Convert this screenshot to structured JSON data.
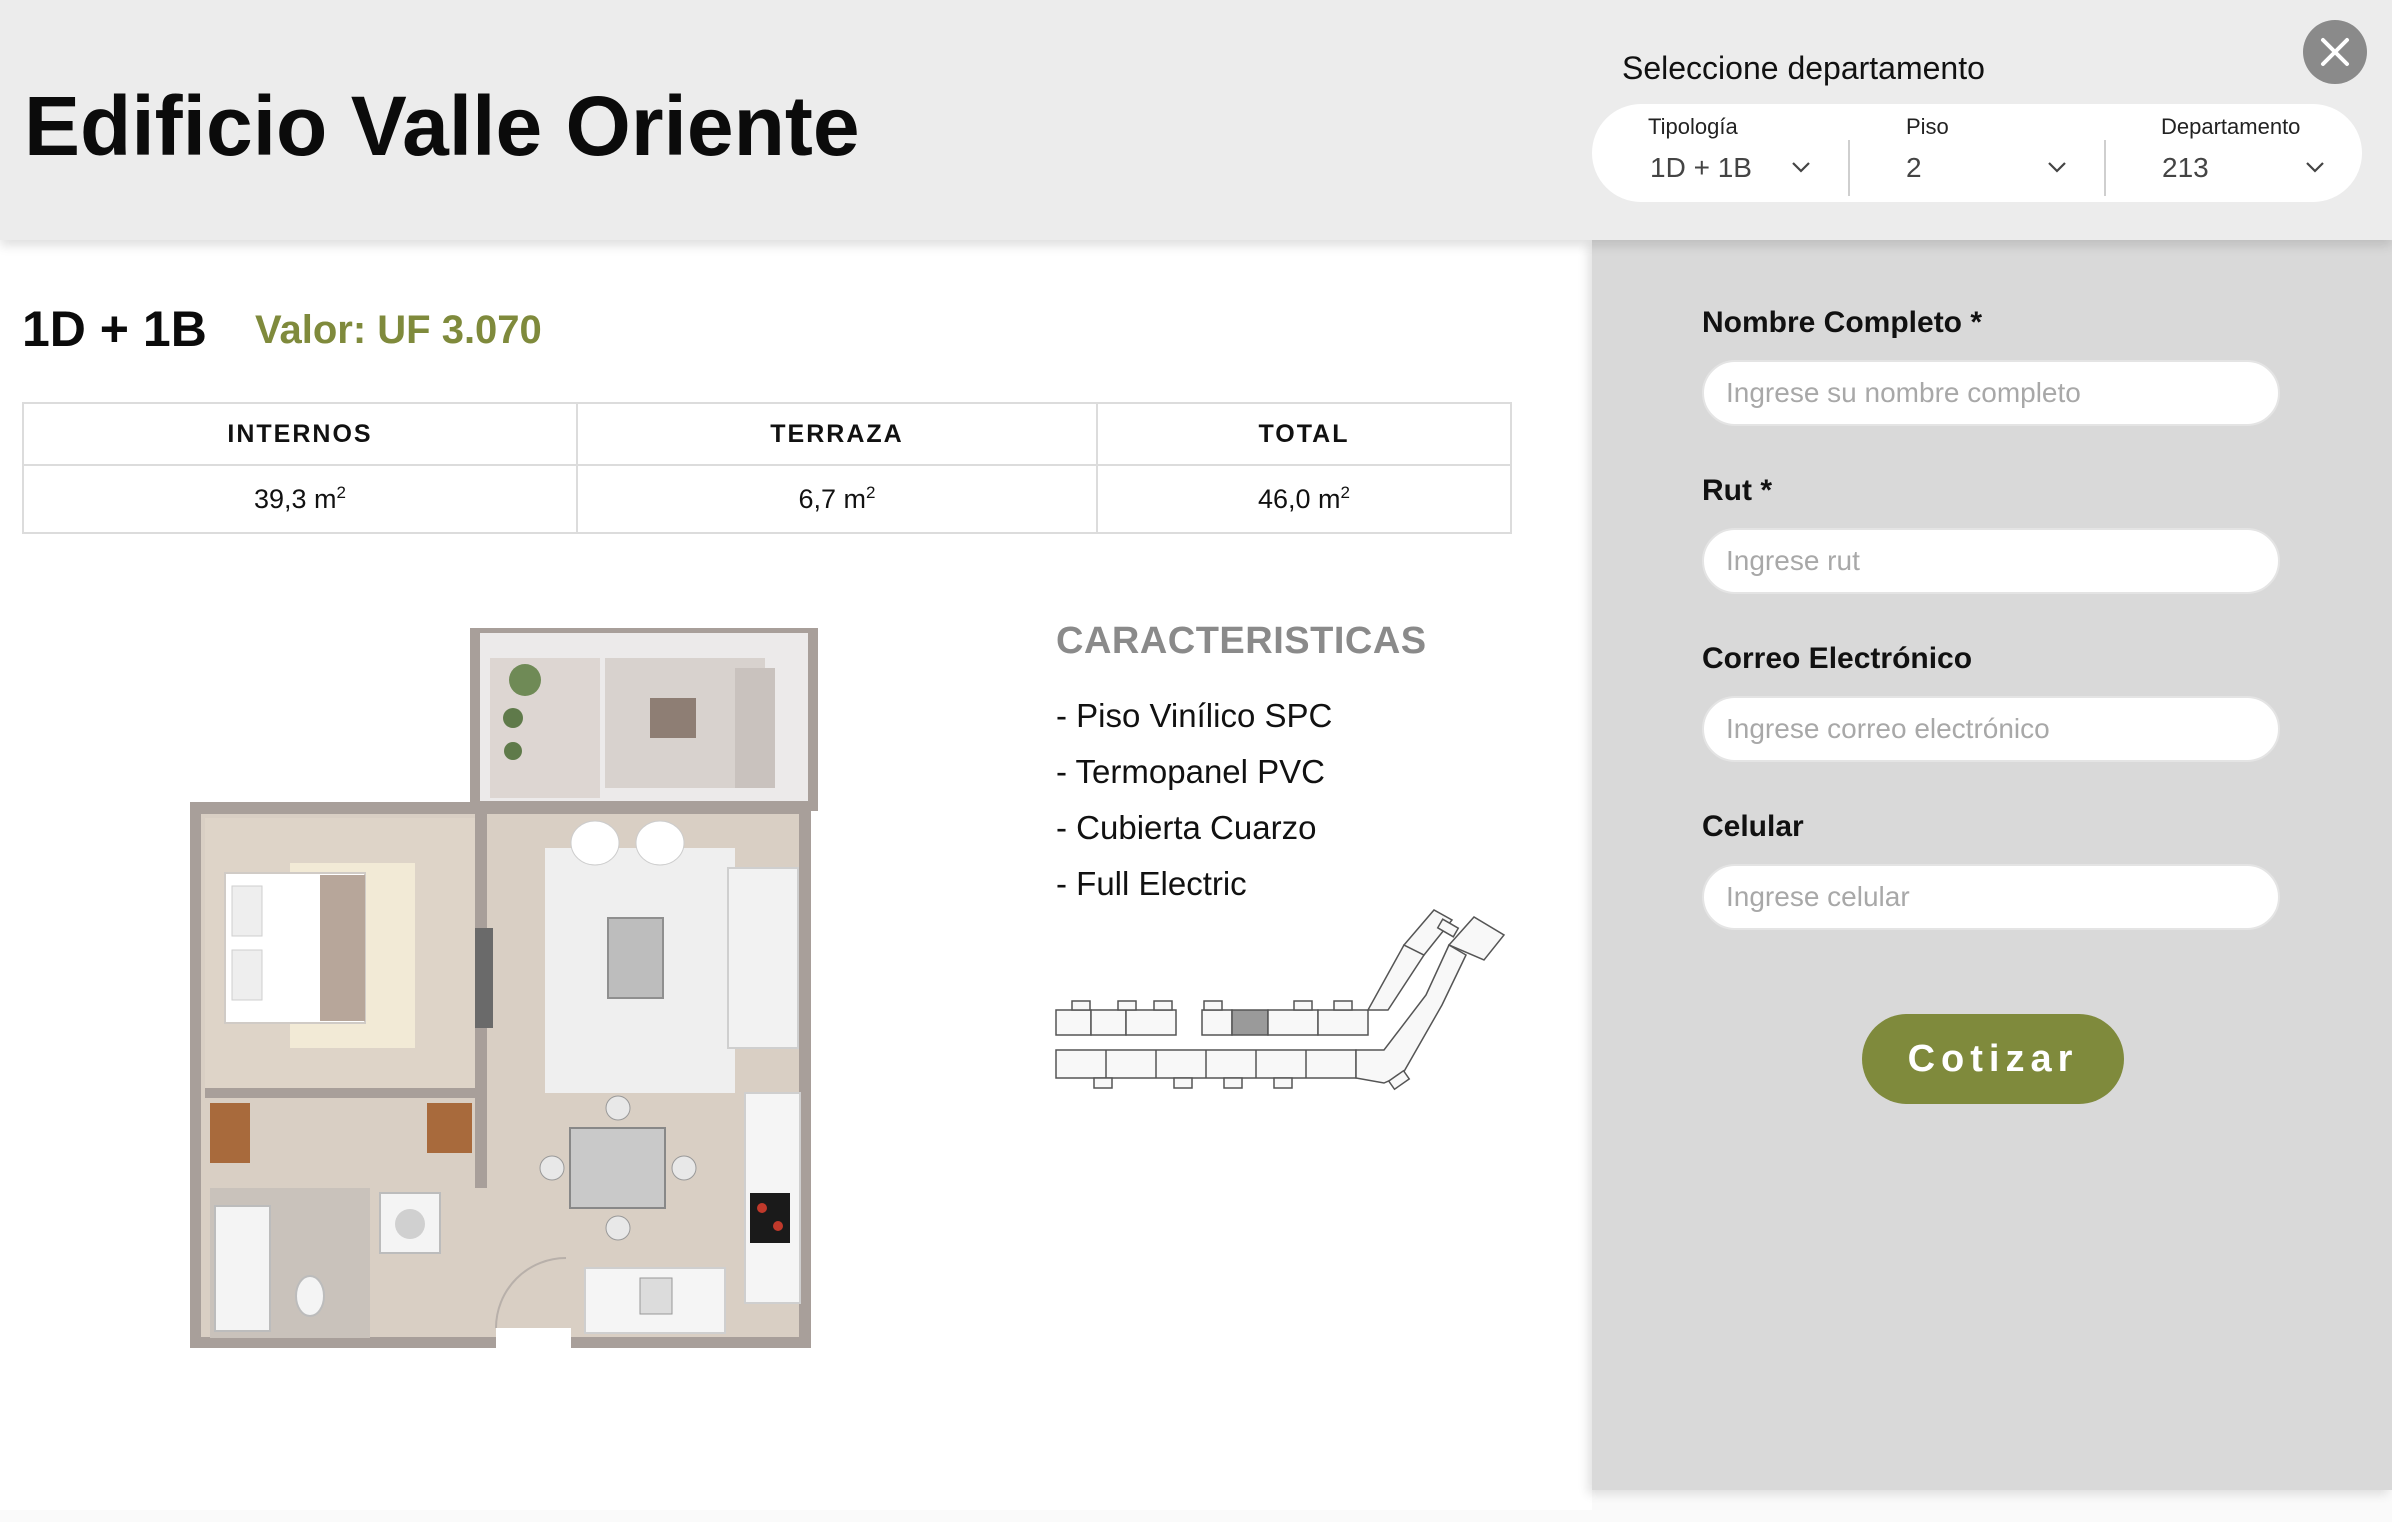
{
  "header": {
    "title": "Edificio Valle Oriente",
    "selector_label": "Seleccione departamento",
    "selects": [
      {
        "label": "Tipología",
        "value": "1D + 1B"
      },
      {
        "label": "Piso",
        "value": "2"
      },
      {
        "label": "Departamento",
        "value": "213"
      }
    ]
  },
  "unit": {
    "type": "1D + 1B",
    "price": "Valor: UF 3.070",
    "columns": [
      "INTERNOS",
      "TERRAZA",
      "TOTAL"
    ],
    "values": [
      "39,3 m",
      "6,7 m",
      "46,0 m"
    ],
    "unit_exp": "2"
  },
  "features": {
    "title": "CARACTERISTICAS",
    "items": [
      "- Piso Vinílico SPC",
      "- Termopanel PVC",
      "- Cubierta Cuarzo",
      "- Full Electric"
    ]
  },
  "form": {
    "fields": [
      {
        "label": "Nombre Completo *",
        "placeholder": "Ingrese su nombre completo"
      },
      {
        "label": "Rut *",
        "placeholder": "Ingrese rut"
      },
      {
        "label": "Correo Electrónico",
        "placeholder": "Ingrese correo electrónico"
      },
      {
        "label": "Celular",
        "placeholder": "Ingrese celular"
      }
    ],
    "submit_label": "Cotizar"
  },
  "icons": {
    "close": "close-icon",
    "chevron": "chevron-down-icon"
  },
  "colors": {
    "accent": "#7f8a3c",
    "panel": "#d9d9d9",
    "header": "#ececec",
    "close": "#8a8a8a"
  }
}
